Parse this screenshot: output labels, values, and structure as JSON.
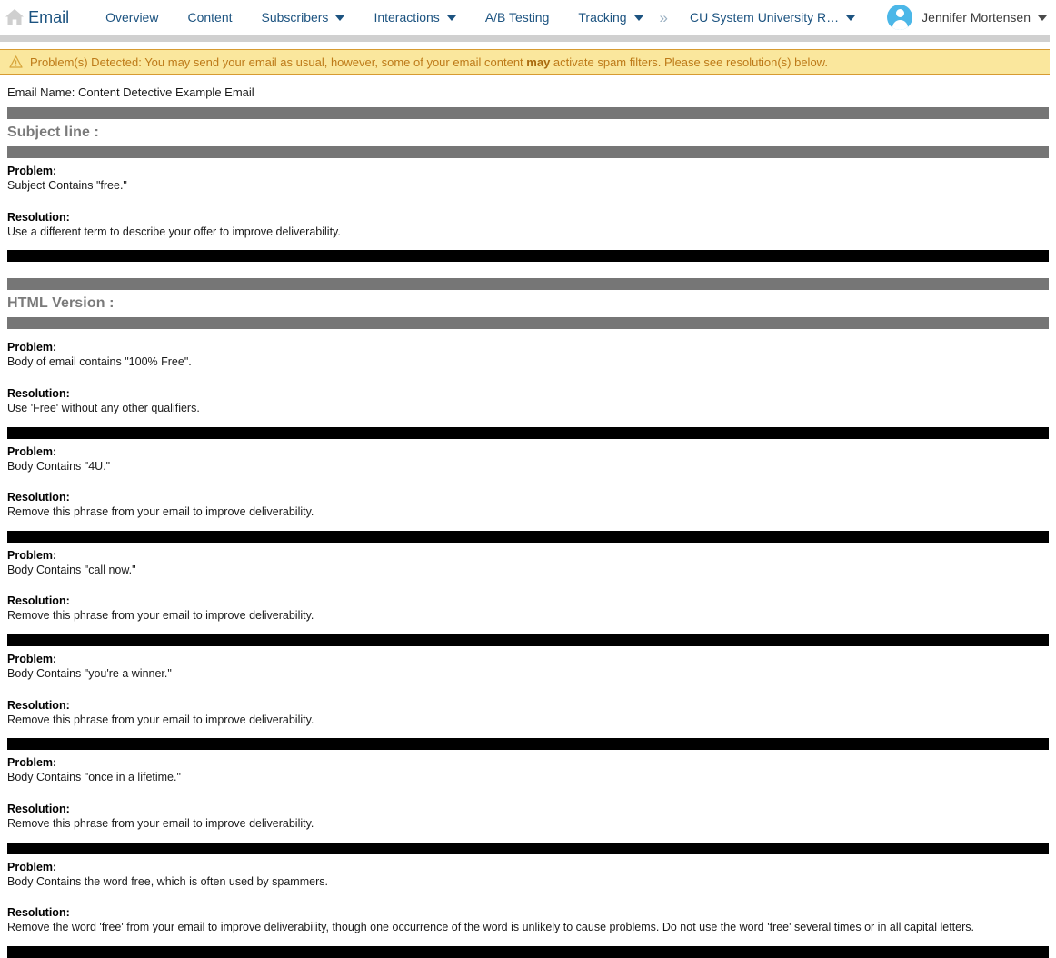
{
  "nav": {
    "home_icon": "home-icon",
    "app_title": "Email",
    "items": [
      {
        "label": "Overview",
        "has_caret": false
      },
      {
        "label": "Content",
        "has_caret": false
      },
      {
        "label": "Subscribers",
        "has_caret": true
      },
      {
        "label": "Interactions",
        "has_caret": true
      },
      {
        "label": "A/B Testing",
        "has_caret": false
      },
      {
        "label": "Tracking",
        "has_caret": true
      }
    ],
    "overflow_glyph": "»",
    "account_label": "CU System University R…",
    "user_name": "Jennifer Mortensen",
    "link_color": "#1c5380",
    "avatar_color": "#4bb7e8"
  },
  "warning": {
    "icon": "warning-triangle-icon",
    "text_before": "Problem(s) Detected: You may send your email as usual, however, some of your email content ",
    "text_bold": "may",
    "text_after": " activate spam filters. Please see resolution(s) below.",
    "background": "#fae79d",
    "border": "#d79b32",
    "text_color": "#bd7a18"
  },
  "report": {
    "email_name_line": "Email Name: Content Detective Example Email",
    "labels": {
      "problem": "Problem:",
      "resolution": "Resolution:"
    },
    "sections": [
      {
        "heading": "Subject line :",
        "issues": [
          {
            "problem": "Subject Contains \"free.\"",
            "resolution": "Use a different term to describe your offer to improve deliverability."
          }
        ]
      },
      {
        "heading": "HTML Version :",
        "issues": [
          {
            "problem": "Body of email contains \"100% Free\".",
            "resolution": "Use 'Free' without any other qualifiers."
          },
          {
            "problem": "Body Contains \"4U.\"",
            "resolution": "Remove this phrase from your email to improve deliverability."
          },
          {
            "problem": "Body Contains \"call now.\"",
            "resolution": "Remove this phrase from your email to improve deliverability."
          },
          {
            "problem": "Body Contains \"you're a winner.\"",
            "resolution": "Remove this phrase from your email to improve deliverability."
          },
          {
            "problem": "Body Contains \"once in a lifetime.\"",
            "resolution": "Remove this phrase from your email to improve deliverability."
          },
          {
            "problem": "Body Contains the word free, which is often used by spammers.",
            "resolution": "Remove the word 'free' from your email to improve deliverability, though one occurrence of the word is unlikely to cause problems. Do not use the word 'free' several times or in all capital letters."
          }
        ]
      }
    ],
    "bar_gray_color": "#767676",
    "bar_black_color": "#000000",
    "heading_color": "#7a7a7a"
  }
}
